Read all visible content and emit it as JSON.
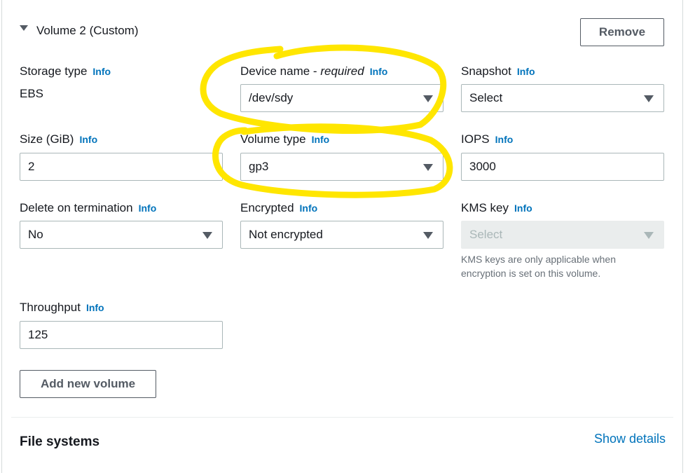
{
  "volume": {
    "title": "Volume 2 (Custom)",
    "remove_label": "Remove"
  },
  "fields": {
    "storage_type": {
      "label": "Storage type",
      "info": "Info",
      "value": "EBS"
    },
    "device_name": {
      "label": "Device name - ",
      "label_em": "required",
      "info": "Info",
      "value": "/dev/sdy"
    },
    "snapshot": {
      "label": "Snapshot",
      "info": "Info",
      "value": "Select"
    },
    "size": {
      "label": "Size (GiB)",
      "info": "Info",
      "value": "2"
    },
    "volume_type": {
      "label": "Volume type",
      "info": "Info",
      "value": "gp3"
    },
    "iops": {
      "label": "IOPS",
      "info": "Info",
      "value": "3000"
    },
    "delete_on_termination": {
      "label": "Delete on termination",
      "info": "Info",
      "value": "No"
    },
    "encrypted": {
      "label": "Encrypted",
      "info": "Info",
      "value": "Not encrypted"
    },
    "kms_key": {
      "label": "KMS key",
      "info": "Info",
      "value": "Select",
      "hint_line1": "KMS keys are only applicable when",
      "hint_line2": "encryption is set on this volume."
    },
    "throughput": {
      "label": "Throughput",
      "info": "Info",
      "value": "125"
    }
  },
  "add_volume_label": "Add new volume",
  "file_systems": {
    "title": "File systems",
    "show_details": "Show details"
  },
  "annotation_color": "#ffe600"
}
